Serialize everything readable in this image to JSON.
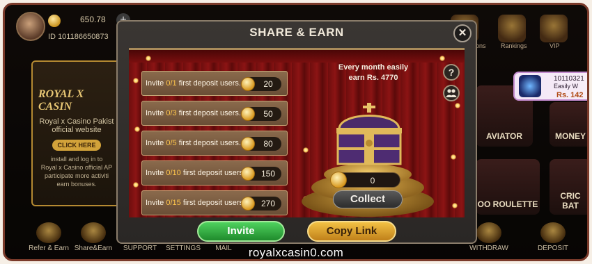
{
  "player": {
    "balance": "650.78",
    "id_prefix": "ID",
    "id": "101186650873"
  },
  "promo": {
    "logo": "ROYAL X CASIN",
    "line1": "Royal x Casino Pakist",
    "line2": "official website",
    "button": "CLICK HERE",
    "small1": "install and log in to",
    "small2": "Royal x Casino official AP",
    "small3": "participate more activiti",
    "small4": "earn bonuses."
  },
  "top_icons": [
    "ions",
    "Rankings",
    "VIP"
  ],
  "notification": {
    "id": "10110321",
    "text": "Easily W",
    "amount": "Rs. 142"
  },
  "tiles": {
    "aviator": "AVIATOR",
    "money": "MONEY",
    "roulette": "OO ROULETTE",
    "crick1": "CRIC",
    "crick2": "BAT"
  },
  "bottom_nav": [
    "Refer & Earn",
    "Share&Earn",
    "SUPPORT",
    "SETTINGS",
    "MAIL",
    "WITHDRAW",
    "DEPOSIT"
  ],
  "modal": {
    "title": "SHARE & EARN",
    "close_symbol": "✕",
    "monthly_line1": "Every month easily",
    "monthly_line2": "earn Rs. 4770",
    "help_symbol": "?",
    "claim_value": "0",
    "collect": "Collect",
    "invite": "Invite",
    "copy_link": "Copy Link",
    "tasks": [
      {
        "prefix": "Invite ",
        "progress": "0/1",
        "suffix": " first deposit users.",
        "reward": "20"
      },
      {
        "prefix": "Invite ",
        "progress": "0/3",
        "suffix": " first deposit users.",
        "reward": "50"
      },
      {
        "prefix": "Invite ",
        "progress": "0/5",
        "suffix": " first deposit users.",
        "reward": "80"
      },
      {
        "prefix": "Invite ",
        "progress": "0/10",
        "suffix": " first deposit users.",
        "reward": "150"
      },
      {
        "prefix": "Invite ",
        "progress": "0/15",
        "suffix": " first deposit users.",
        "reward": "270"
      }
    ]
  },
  "watermark": "royalxcasin0.com",
  "icons": {
    "coin": "coin-icon",
    "close": "close-icon",
    "help": "help-icon",
    "friends": "friends-icon",
    "chest": "treasure-chest-icon"
  },
  "colors": {
    "accent_gold": "#ffc64a",
    "invite_green": "#1f8a2c",
    "copy_gold": "#c0801a",
    "curtain_red": "#8c1414"
  }
}
